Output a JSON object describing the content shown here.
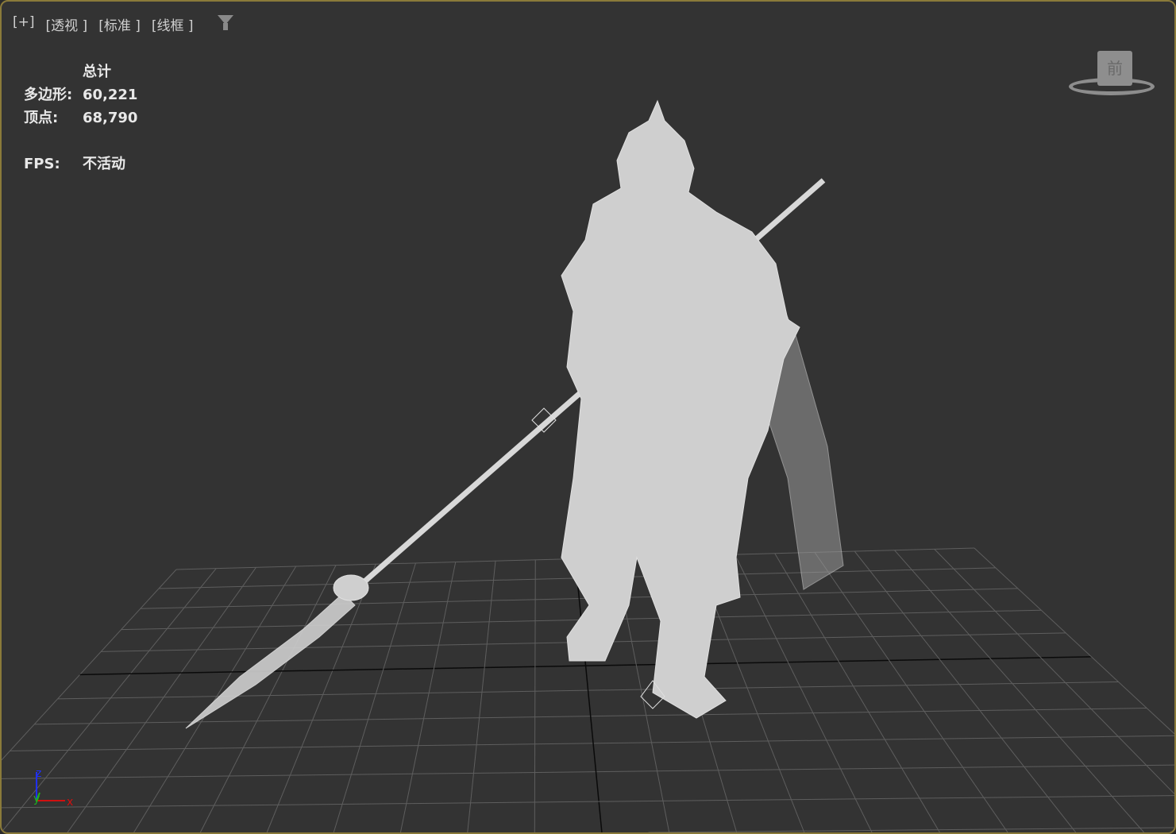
{
  "viewport_labels": [
    "[+]",
    "[透视 ]",
    "[标准 ]",
    "[线框 ]"
  ],
  "stats": {
    "header": "总计",
    "rows": [
      {
        "label": "多边形:",
        "value": "60,221"
      },
      {
        "label": "顶点:",
        "value": "68,790"
      },
      {
        "label": "FPS:",
        "value": "不活动"
      }
    ]
  },
  "viewcube": {
    "face": "前"
  },
  "axis": {
    "x": "x",
    "y": "y",
    "z": "z"
  },
  "colors": {
    "border": "#8a7a3a",
    "background": "#333333",
    "grid": "#5e5e5e",
    "wire": "#d4d4d4"
  }
}
